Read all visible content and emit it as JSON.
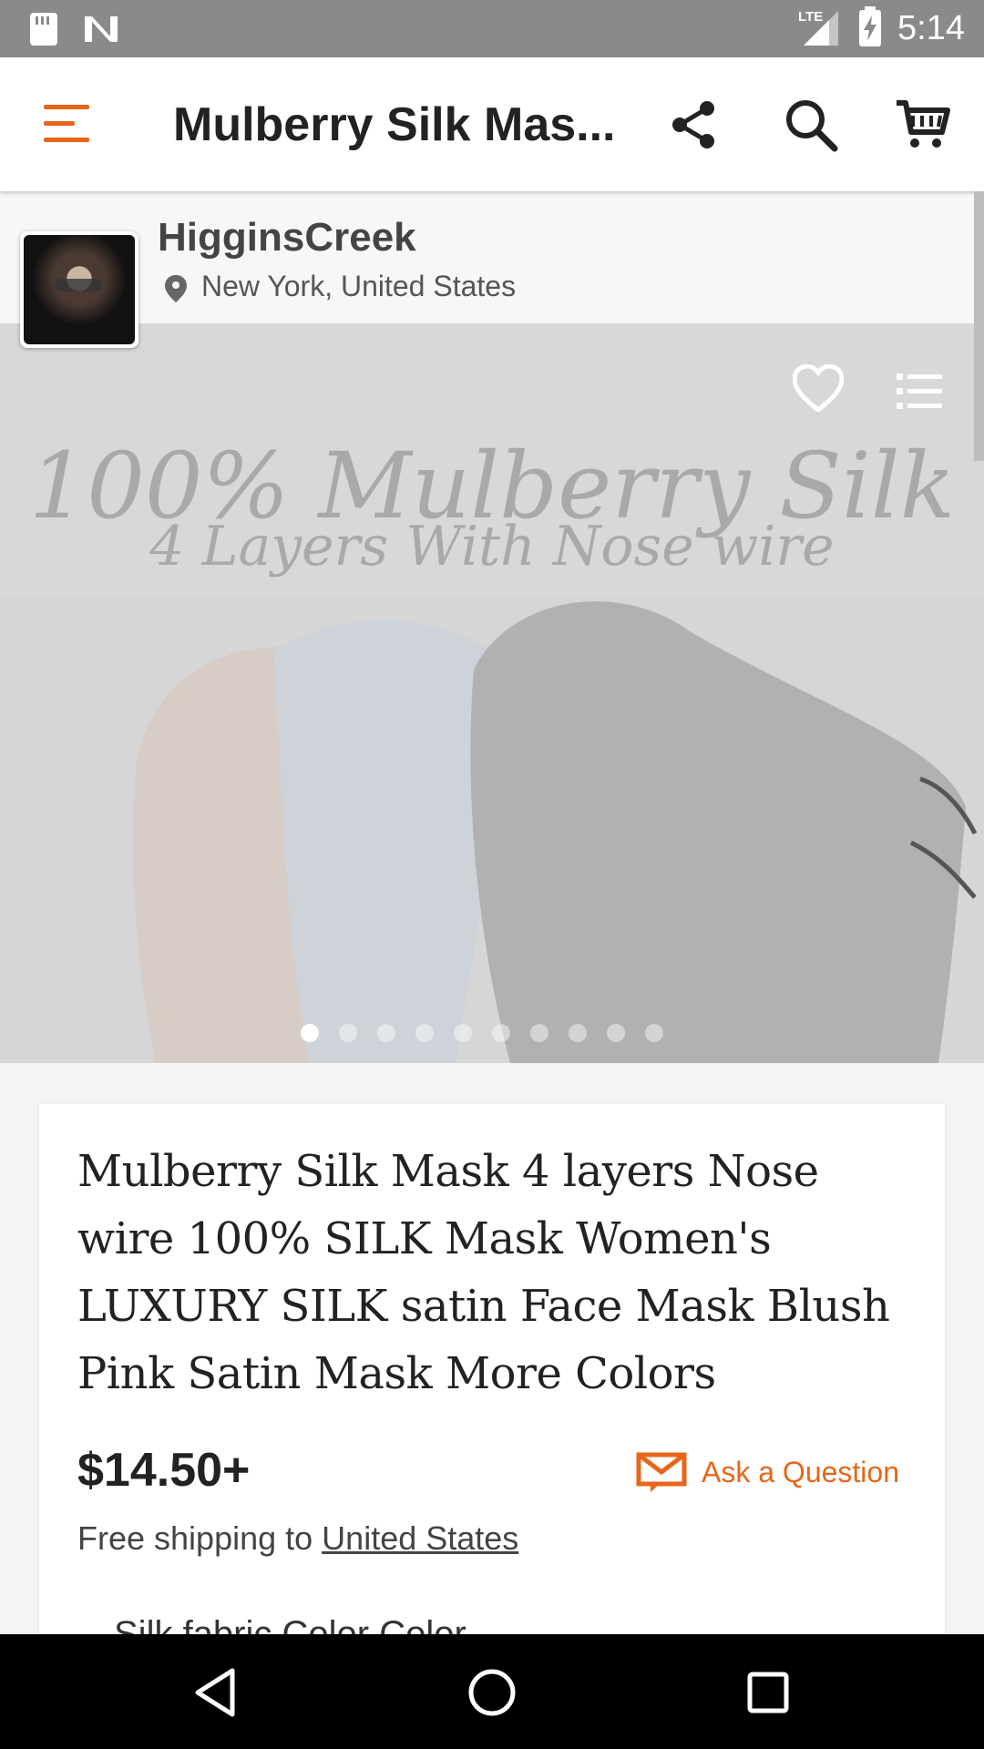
{
  "status_bar": {
    "time": "5:14",
    "network": "LTE"
  },
  "toolbar": {
    "title": "Mulberry Silk Mas...",
    "icons": [
      "menu-icon",
      "share-icon",
      "search-icon",
      "cart-icon"
    ]
  },
  "shop": {
    "name": "HigginsCreek",
    "location": "New York, United States"
  },
  "carousel": {
    "image_text_line1": "100% Mulberry Silk",
    "image_text_line2": "4 Layers With Nose wire",
    "dots_count": 10,
    "active_index": 0
  },
  "listing": {
    "title": "Mulberry Silk Mask 4 layers Nose wire 100% SILK Mask Women's LUXURY SILK satin Face Mask Blush Pink Satin Mask More Colors",
    "price": "$14.50+",
    "ask_label": "Ask a Question",
    "shipping_prefix": "Free shipping to",
    "shipping_destination": "United States",
    "next_section_peek": "Silk fabric Color Color"
  },
  "colors": {
    "accent": "#e8661a",
    "status_bar": "#8a8a8a",
    "nav_bar": "#000000"
  }
}
